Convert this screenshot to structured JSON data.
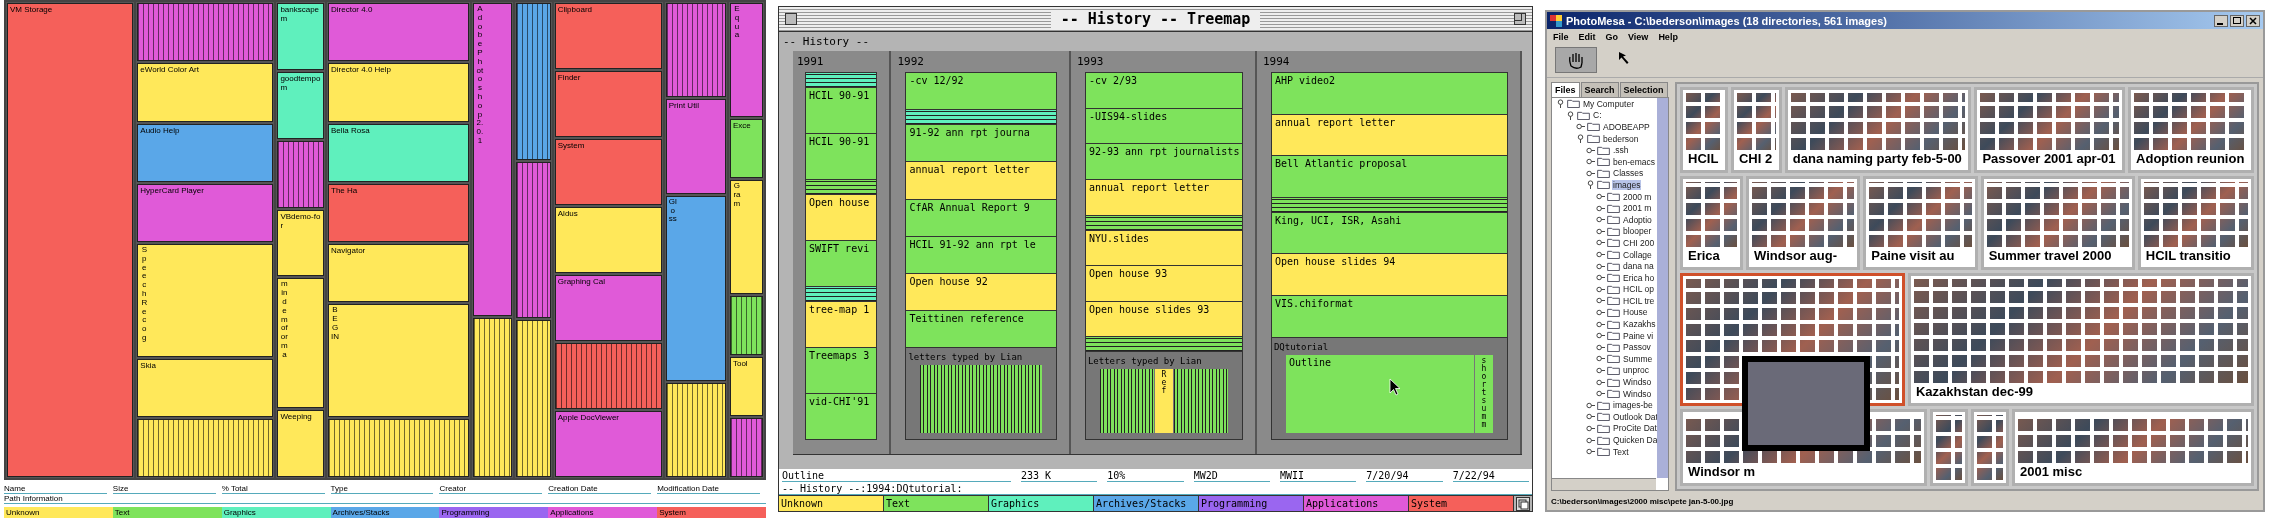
{
  "file_treemap": {
    "columns": [
      {
        "blocks": [
          {
            "kind": "block",
            "color": "#f5605a",
            "label": "VM Storage"
          }
        ]
      },
      {
        "blocks": [
          {
            "kind": "plain",
            "color": "#e05ad8"
          },
          {
            "kind": "block",
            "color": "#ffe85a",
            "label": "eWorld Color Art"
          },
          {
            "kind": "block",
            "color": "#5aa7e8",
            "label": "Audio Help"
          },
          {
            "kind": "block",
            "color": "#e05ad8",
            "label": "HyperCard Player"
          },
          {
            "kind": "vblock",
            "color": "#ffe85a",
            "label": "Speech Recog"
          },
          {
            "kind": "block",
            "color": "#ffe85a",
            "label": "Skia"
          },
          {
            "kind": "plain",
            "color": "#ffe85a"
          }
        ]
      },
      {
        "blocks": [
          {
            "kind": "block",
            "color": "#5ff0bd",
            "label": "bankscapem"
          },
          {
            "kind": "block",
            "color": "#5ff0bd",
            "label": "goodtempom"
          },
          {
            "kind": "plain",
            "color": "#e05ad8"
          },
          {
            "kind": "block",
            "color": "#ffe85a",
            "label": "VBdemo-for"
          },
          {
            "kind": "vblock",
            "color": "#ffe85a",
            "label": "mindemoforma"
          },
          {
            "kind": "block",
            "color": "#ffe85a",
            "label": "Weeping"
          }
        ]
      },
      {
        "blocks": [
          {
            "kind": "block",
            "color": "#e05ad8",
            "label": "Director 4.0"
          },
          {
            "kind": "block",
            "color": "#ffe85a",
            "label": "Director 4.0 Help"
          },
          {
            "kind": "block",
            "color": "#5ff0bd",
            "label": "Bella Rosa"
          },
          {
            "kind": "block",
            "color": "#f5605a",
            "label": "The Ha"
          },
          {
            "kind": "block",
            "color": "#ffe85a",
            "label": "Navigator"
          },
          {
            "kind": "vblock",
            "color": "#ffe85a",
            "label": "BEGIN"
          },
          {
            "kind": "plain",
            "color": "#ffe85a"
          }
        ]
      },
      {
        "blocks": [
          {
            "kind": "vblock",
            "color": "#e05ad8",
            "label": "Adobe Photoshop 2.0.1"
          },
          {
            "kind": "plain",
            "color": "#ffe85a"
          }
        ]
      },
      {
        "blocks": [
          {
            "kind": "plain",
            "color": "#5aa7e8"
          },
          {
            "kind": "plain",
            "color": "#e05ad8"
          },
          {
            "kind": "plain",
            "color": "#ffe85a"
          }
        ]
      },
      {
        "blocks": [
          {
            "kind": "block",
            "color": "#f5605a",
            "label": "Clipboard"
          },
          {
            "kind": "block",
            "color": "#f5605a",
            "label": "Finder"
          },
          {
            "kind": "block",
            "color": "#f5605a",
            "label": "System"
          },
          {
            "kind": "block",
            "color": "#ffe85a",
            "label": "Aldus"
          },
          {
            "kind": "block",
            "color": "#e05ad8",
            "label": "Graphing Cal"
          },
          {
            "kind": "plain",
            "color": "#f5605a"
          },
          {
            "kind": "block",
            "color": "#e05ad8",
            "label": "Apple DocViewer"
          }
        ]
      },
      {
        "blocks": [
          {
            "kind": "plain",
            "color": "#e05ad8"
          },
          {
            "kind": "block",
            "color": "#e05ad8",
            "label": "Print Util"
          },
          {
            "kind": "vblock",
            "color": "#5aa7e8",
            "label": "Gloss"
          },
          {
            "kind": "plain",
            "color": "#ffe85a"
          }
        ]
      },
      {
        "blocks": [
          {
            "kind": "vblock",
            "color": "#e05ad8",
            "label": "Equa"
          },
          {
            "kind": "block",
            "color": "#7ee35c",
            "label": "Exce"
          },
          {
            "kind": "vblock",
            "color": "#ffe85a",
            "label": "Gram"
          },
          {
            "kind": "plain",
            "color": "#7ee35c"
          },
          {
            "kind": "block",
            "color": "#ffe85a",
            "label": "Tool"
          },
          {
            "kind": "plain",
            "color": "#e05ad8"
          }
        ]
      }
    ],
    "field_labels": [
      "Name",
      "Size",
      "% Total",
      "Type",
      "Creator",
      "Creation Date",
      "Modification Date"
    ],
    "path_label": "Path Information",
    "legend": [
      {
        "color": "#ffe85a",
        "label": "Unknown"
      },
      {
        "color": "#7ee35c",
        "label": "Text"
      },
      {
        "color": "#5ff0bd",
        "label": "Graphics"
      },
      {
        "color": "#5aa7e8",
        "label": "Archives/Stacks"
      },
      {
        "color": "#9a66f0",
        "label": "Programming"
      },
      {
        "color": "#e05ad8",
        "label": "Applications"
      },
      {
        "color": "#f5605a",
        "label": "System"
      }
    ]
  },
  "history_treemap": {
    "window": {
      "title": "-- History -- Treemap"
    },
    "root_label": "-- History --",
    "years": [
      {
        "label": "1991",
        "items": [
          {
            "kind": "stripes",
            "color": "#5ff0bd"
          },
          {
            "kind": "file",
            "color": "#7ee35c",
            "label": "HCIL 90-91"
          },
          {
            "kind": "file",
            "color": "#7ee35c",
            "label": "HCIL 90-91"
          },
          {
            "kind": "stripes",
            "color": "#7ee35c"
          },
          {
            "kind": "file",
            "color": "#ffe85a",
            "label": "Open house"
          },
          {
            "kind": "file",
            "color": "#7ee35c",
            "label": "SWIFT revi"
          },
          {
            "kind": "stripes",
            "color": "#5ff0bd"
          },
          {
            "kind": "file",
            "color": "#ffe85a",
            "label": "tree-map 1"
          },
          {
            "kind": "file",
            "color": "#7ee35c",
            "label": "Treemaps 3"
          },
          {
            "kind": "file",
            "color": "#7ee35c",
            "label": "vid-CHI'91"
          }
        ]
      },
      {
        "label": "1992",
        "items": [
          {
            "kind": "file",
            "color": "#7ee35c",
            "label": "-cv  12/92"
          },
          {
            "kind": "stripes",
            "color": "#5ff0bd"
          },
          {
            "kind": "file",
            "color": "#7ee35c",
            "label": "91-92 ann rpt journa"
          },
          {
            "kind": "file",
            "color": "#ffe85a",
            "label": "annual report letter"
          },
          {
            "kind": "file",
            "color": "#7ee35c",
            "label": "CfAR Annual Report 9"
          },
          {
            "kind": "file",
            "color": "#7ee35c",
            "label": "HCIL 91-92 ann rpt le"
          },
          {
            "kind": "file",
            "color": "#ffe85a",
            "label": "Open house 92"
          },
          {
            "kind": "file",
            "color": "#7ee35c",
            "label": "Teittinen reference"
          },
          {
            "kind": "group",
            "label": "letters typed by Lian",
            "children": [
              {
                "kind": "barcode"
              }
            ]
          }
        ]
      },
      {
        "label": "1993",
        "items": [
          {
            "kind": "file",
            "color": "#7ee35c",
            "label": "-cv  2/93"
          },
          {
            "kind": "file",
            "color": "#7ee35c",
            "label": "-UIS94-slides"
          },
          {
            "kind": "file",
            "color": "#7ee35c",
            "label": "92-93 ann rpt journalists"
          },
          {
            "kind": "file",
            "color": "#ffe85a",
            "label": "annual report letter"
          },
          {
            "kind": "stripes",
            "color": "#7ee35c"
          },
          {
            "kind": "file",
            "color": "#ffe85a",
            "label": "NYU.slides"
          },
          {
            "kind": "file",
            "color": "#ffe85a",
            "label": "Open house 93"
          },
          {
            "kind": "file",
            "color": "#ffe85a",
            "label": "Open house slides 93"
          },
          {
            "kind": "stripes",
            "color": "#7ee35c"
          },
          {
            "kind": "group",
            "label": "Letters typed by Lian",
            "children": [
              {
                "kind": "barcode"
              },
              {
                "kind": "vfile",
                "color": "#ffe85a",
                "label": "Ref"
              },
              {
                "kind": "barcode"
              }
            ]
          }
        ]
      },
      {
        "label": "1994",
        "items": [
          {
            "kind": "file",
            "color": "#7ee35c",
            "label": "AHP video2"
          },
          {
            "kind": "file",
            "color": "#ffe85a",
            "label": "annual report letter"
          },
          {
            "kind": "file",
            "color": "#7ee35c",
            "label": "Bell Atlantic proposal"
          },
          {
            "kind": "stripes",
            "color": "#7ee35c"
          },
          {
            "kind": "file",
            "color": "#7ee35c",
            "label": "King, UCI, ISR, Asahi"
          },
          {
            "kind": "file",
            "color": "#ffe85a",
            "label": "Open house slides 94"
          },
          {
            "kind": "file",
            "color": "#7ee35c",
            "label": "VIS.chiformat"
          },
          {
            "kind": "group",
            "label": "DQtutorial",
            "children": [
              {
                "kind": "file",
                "color": "#7ee35c",
                "label": "Outline"
              },
              {
                "kind": "vfile",
                "color": "#7ee35c",
                "label": "short summ"
              }
            ]
          }
        ]
      }
    ],
    "fields": [
      "Outline",
      "233 K",
      "10%",
      "MW2D",
      "MWII",
      "7/20/94",
      "7/22/94"
    ],
    "path": "-- History --:1994:DQtutorial:",
    "legend": [
      {
        "color": "#ffe85a",
        "label": "Unknown"
      },
      {
        "color": "#7ee35c",
        "label": "Text"
      },
      {
        "color": "#5ff0bd",
        "label": "Graphics"
      },
      {
        "color": "#5aa7e8",
        "label": "Archives/Stacks"
      },
      {
        "color": "#9a66f0",
        "label": "Programming"
      },
      {
        "color": "#e05ad8",
        "label": "Applications"
      },
      {
        "color": "#f5605a",
        "label": "System"
      }
    ]
  },
  "photomesa": {
    "window": {
      "title": "PhotoMesa - C:\\bederson\\images (18 directories, 561 images)"
    },
    "menu": [
      "File",
      "Edit",
      "Go",
      "View",
      "Help"
    ],
    "tools": [
      {
        "kind": "hand",
        "selected": true
      },
      {
        "kind": "arrow",
        "selected": false
      }
    ],
    "tabs": [
      {
        "label": "Files",
        "selected": true
      },
      {
        "label": "Search",
        "selected": false
      },
      {
        "label": "Selection",
        "selected": false
      }
    ],
    "tree": [
      {
        "label": "My Computer",
        "expanded": true,
        "selected": false,
        "children": [
          {
            "label": "C:",
            "expanded": true,
            "selected": false,
            "children": [
              {
                "label": "ADOBEAPP",
                "expanded": false,
                "selected": false
              },
              {
                "label": "bederson",
                "expanded": true,
                "selected": false,
                "children": [
                  {
                    "label": ".ssh",
                    "expanded": false,
                    "selected": false
                  },
                  {
                    "label": "ben-emacs",
                    "expanded": false,
                    "selected": false
                  },
                  {
                    "label": "Classes",
                    "expanded": false,
                    "selected": false
                  },
                  {
                    "label": "images",
                    "expanded": true,
                    "selected": true,
                    "children": [
                      {
                        "label": "2000 m",
                        "expanded": false,
                        "selected": false
                      },
                      {
                        "label": "2001 m",
                        "expanded": false,
                        "selected": false
                      },
                      {
                        "label": "Adoptio",
                        "expanded": false,
                        "selected": false
                      },
                      {
                        "label": "blooper",
                        "expanded": false,
                        "selected": false
                      },
                      {
                        "label": "CHI 200",
                        "expanded": false,
                        "selected": false
                      },
                      {
                        "label": "Collage",
                        "expanded": false,
                        "selected": false
                      },
                      {
                        "label": "dana na",
                        "expanded": false,
                        "selected": false
                      },
                      {
                        "label": "Erica ho",
                        "expanded": false,
                        "selected": false
                      },
                      {
                        "label": "HCIL op",
                        "expanded": false,
                        "selected": false
                      },
                      {
                        "label": "HCIL tre",
                        "expanded": false,
                        "selected": false
                      },
                      {
                        "label": "House",
                        "expanded": false,
                        "selected": false
                      },
                      {
                        "label": "Kazakhs",
                        "expanded": false,
                        "selected": false
                      },
                      {
                        "label": "Paine vi",
                        "expanded": false,
                        "selected": false
                      },
                      {
                        "label": "Passov",
                        "expanded": false,
                        "selected": false
                      },
                      {
                        "label": "Summe",
                        "expanded": false,
                        "selected": false
                      },
                      {
                        "label": "unproc",
                        "expanded": false,
                        "selected": false
                      },
                      {
                        "label": "Windso",
                        "expanded": false,
                        "selected": false
                      },
                      {
                        "label": "Windso",
                        "expanded": false,
                        "selected": false
                      }
                    ]
                  },
                  {
                    "label": "images-be",
                    "expanded": false,
                    "selected": false
                  },
                  {
                    "label": "Outlook Dat",
                    "expanded": false,
                    "selected": false
                  },
                  {
                    "label": "ProCite Dat",
                    "expanded": false,
                    "selected": false
                  },
                  {
                    "label": "Quicken Da",
                    "expanded": false,
                    "selected": false
                  },
                  {
                    "label": "Text",
                    "expanded": false,
                    "selected": false
                  }
                ]
              }
            ]
          }
        ]
      }
    ],
    "rows": [
      {
        "groups": [
          {
            "label": "HCIL",
            "selected": false
          },
          {
            "label": "CHI 2",
            "selected": false
          },
          {
            "label": "dana naming party feb-5-00",
            "selected": false
          },
          {
            "label": "Passover 2001 apr-01",
            "selected": false
          },
          {
            "label": "Adoption reunion",
            "selected": false
          }
        ]
      },
      {
        "groups": [
          {
            "label": "Erica",
            "selected": false
          },
          {
            "label": "Windsor aug-",
            "selected": false
          },
          {
            "label": "Paine visit au",
            "selected": false
          },
          {
            "label": "Summer travel 2000",
            "selected": false
          },
          {
            "label": "HCIL transitio",
            "selected": false
          }
        ]
      },
      {
        "groups": [
          {
            "selected": true
          },
          {
            "label": "Kazakhstan dec-99",
            "selected": false
          }
        ]
      },
      {
        "groups": [
          {
            "label": "Windsor m",
            "selected": false
          },
          {
            "selected": false
          },
          {
            "selected": false
          },
          {
            "label": "2001 misc",
            "selected": false
          }
        ]
      }
    ],
    "status": "C:\\bederson\\images\\2000 misc\\pete jan-5-00.jpg"
  }
}
